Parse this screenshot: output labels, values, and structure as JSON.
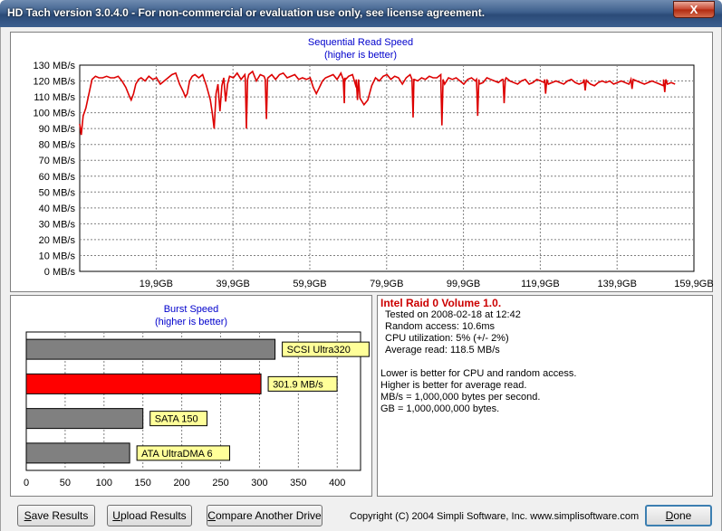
{
  "window": {
    "title": "HD Tach version 3.0.4.0  - For non-commercial or evaluation use only, see license agreement.",
    "close_label": "X"
  },
  "colors": {
    "accent_red": "#dd0000",
    "bar_gray": "#808080",
    "title_blue": "#0000cc",
    "label_yellow": "#ffff99"
  },
  "chart_data": [
    {
      "type": "line",
      "title": "Sequential Read Speed",
      "subtitle": "(higher is better)",
      "y_tick_labels": [
        "130 MB/s",
        "120 MB/s",
        "110 MB/s",
        "100 MB/s",
        "90 MB/s",
        "80 MB/s",
        "70 MB/s",
        "60 MB/s",
        "50 MB/s",
        "40 MB/s",
        "30 MB/s",
        "20 MB/s",
        "10 MB/s",
        "0 MB/s"
      ],
      "x_tick_labels": [
        "19,9GB",
        "39,9GB",
        "59,9GB",
        "79,9GB",
        "99,9GB",
        "119,9GB",
        "139,9GB",
        "159,9GB"
      ],
      "x_ticks": [
        19.9,
        39.9,
        59.9,
        79.9,
        99.9,
        119.9,
        139.9,
        159.9
      ],
      "xlim": [
        0,
        159.9
      ],
      "ylim": [
        0,
        130
      ],
      "grid": true,
      "series_color": "#dd0000",
      "x": [
        0,
        0.4,
        0.9,
        1.6,
        2.4,
        3.2,
        4.1,
        5,
        6,
        7,
        8,
        9,
        10,
        11,
        12,
        13,
        13.4,
        14,
        14.6,
        15.3,
        16,
        17,
        18,
        19,
        20,
        21,
        22,
        23,
        24,
        25,
        26,
        27,
        27.5,
        28,
        28.6,
        29.3,
        30,
        31,
        32,
        33,
        34,
        34.5,
        35,
        35.5,
        36,
        36.5,
        37,
        37.5,
        38,
        38.5,
        39,
        40,
        41,
        42,
        43,
        44,
        45,
        46,
        47,
        48,
        49,
        50,
        51,
        52,
        53,
        54,
        55,
        56,
        57,
        58,
        59,
        60,
        60.8,
        61.6,
        62.4,
        63.2,
        64,
        65,
        66,
        67,
        68,
        69,
        70,
        71,
        72,
        73,
        74,
        75,
        76,
        77,
        78,
        79,
        80,
        81,
        82,
        83,
        84,
        85,
        86,
        87,
        88,
        89,
        90,
        91,
        92,
        93,
        94,
        95,
        96,
        97,
        98,
        99,
        100,
        101,
        102,
        103,
        104,
        105,
        106,
        107,
        108,
        109,
        110,
        111,
        112,
        113,
        114,
        115,
        116,
        117,
        118,
        119,
        120,
        121,
        122,
        123,
        124,
        125,
        126,
        127,
        128,
        129,
        130,
        131,
        132,
        133,
        134,
        135,
        136,
        137,
        138,
        139,
        140,
        141,
        142,
        143,
        144,
        145,
        146,
        147,
        148,
        149,
        150,
        151,
        152,
        153,
        154,
        155,
        156,
        157,
        158,
        159,
        159.9
      ],
      "y": [
        93,
        86,
        98,
        103,
        112,
        121,
        123,
        122,
        122,
        123,
        122,
        122,
        123,
        120,
        116,
        110,
        108,
        112,
        118,
        121,
        122,
        120,
        123,
        121,
        122,
        118,
        120,
        122,
        124,
        125,
        118,
        113,
        110,
        112,
        120,
        123,
        124,
        122,
        124,
        117,
        108,
        100,
        90,
        112,
        118,
        101,
        117,
        122,
        107,
        118,
        123,
        122,
        125,
        121,
        124,
        124,
        126,
        120,
        124,
        123,
        122,
        124,
        121,
        124,
        125,
        122,
        123,
        124,
        121,
        122,
        121,
        122,
        116,
        112,
        116,
        120,
        122,
        123,
        124,
        121,
        125,
        122,
        123,
        124,
        116,
        109,
        105,
        108,
        117,
        122,
        120,
        123,
        124,
        121,
        123,
        122,
        118,
        122,
        124,
        121,
        120,
        122,
        121,
        123,
        122,
        122,
        124,
        118,
        122,
        121,
        122,
        120,
        118,
        121,
        122,
        120,
        118,
        119,
        122,
        121,
        120,
        119,
        121,
        122,
        120,
        119,
        118,
        120,
        121,
        118,
        119,
        121,
        120,
        119,
        118,
        119,
        120,
        119,
        118,
        120,
        121,
        119,
        118,
        119,
        120,
        118,
        117,
        119,
        120,
        119,
        120,
        118,
        119,
        120,
        119,
        118,
        119,
        120,
        119,
        118,
        119,
        120,
        119,
        118,
        117,
        118,
        119,
        118
      ],
      "dips": [
        [
          43.4,
          90
        ],
        [
          48.6,
          96
        ],
        [
          68.9,
          106
        ],
        [
          72.3,
          108
        ],
        [
          86.8,
          97
        ],
        [
          94.3,
          92
        ],
        [
          103.6,
          98
        ],
        [
          110.5,
          106
        ],
        [
          121.3,
          112
        ],
        [
          131.6,
          114
        ],
        [
          143.8,
          115
        ],
        [
          152.3,
          113
        ]
      ]
    },
    {
      "type": "bar",
      "title": "Burst Speed",
      "subtitle": "(higher is better)",
      "orientation": "horizontal",
      "x_tick_labels": [
        "0",
        "50",
        "100",
        "150",
        "200",
        "250",
        "300",
        "350",
        "400"
      ],
      "xlim": [
        0,
        430
      ],
      "categories": [
        "SCSI Ultra320",
        "301.9 MB/s",
        "SATA 150",
        "ATA UltraDMA 6"
      ],
      "values": [
        320,
        301.9,
        150,
        133
      ],
      "colors": [
        "#808080",
        "#ff0000",
        "#808080",
        "#808080"
      ]
    }
  ],
  "info": {
    "drive_title": "Intel Raid 0 Volume 1.0.",
    "tested_on": "Tested on 2008-02-18 at 12:42",
    "random_access": "Random access: 10.6ms",
    "cpu_util": "CPU utilization: 5% (+/- 2%)",
    "avg_read": "Average read: 118.5 MB/s",
    "notes": [
      "Lower is better for CPU and random access.",
      "Higher is better for average read.",
      "MB/s = 1,000,000 bytes per second.",
      "GB = 1,000,000,000 bytes."
    ]
  },
  "buttons": {
    "save_first": "S",
    "save_rest": "ave Results",
    "upload_first": "U",
    "upload_rest": "pload Results",
    "compare_first": "C",
    "compare_rest": "ompare Another Drive",
    "done_first": "D",
    "done_rest": "one"
  },
  "footer": {
    "copyright": "Copyright (C) 2004 Simpli Software, Inc. www.simplisoftware.com"
  }
}
